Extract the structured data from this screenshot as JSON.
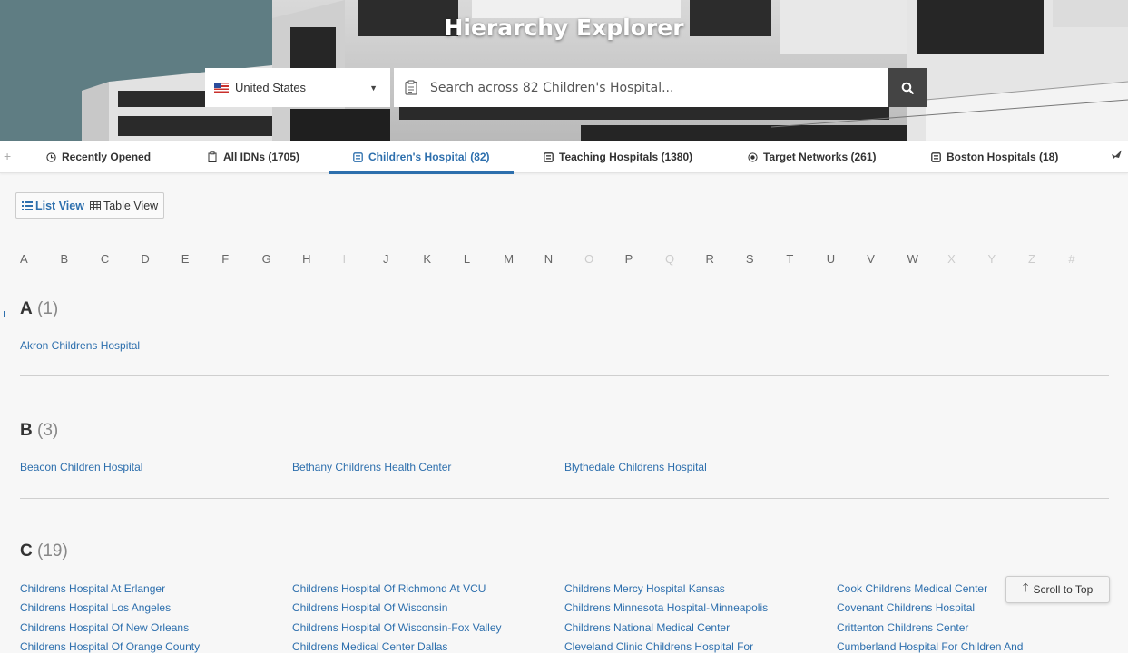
{
  "header": {
    "title": "Hierarchy Explorer",
    "country": "United States",
    "search_placeholder": "Search across 82 Children's Hospital..."
  },
  "tabs": [
    {
      "label": "Recently Opened",
      "icon": "clock-icon"
    },
    {
      "label": "All IDNs (1705)",
      "icon": "clipboard-icon"
    },
    {
      "label": "Children's Hospital (82)",
      "icon": "list-box-icon",
      "active": true
    },
    {
      "label": "Teaching Hospitals (1380)",
      "icon": "list-box-icon"
    },
    {
      "label": "Target Networks (261)",
      "icon": "target-icon"
    },
    {
      "label": "Boston Hospitals (18)",
      "icon": "list-box-icon"
    }
  ],
  "view_toggle": {
    "list_label": "List View",
    "table_label": "Table View"
  },
  "alphabet": [
    "A",
    "B",
    "C",
    "D",
    "E",
    "F",
    "G",
    "H",
    "I",
    "J",
    "K",
    "L",
    "M",
    "N",
    "O",
    "P",
    "Q",
    "R",
    "S",
    "T",
    "U",
    "V",
    "W",
    "X",
    "Y",
    "Z",
    "#"
  ],
  "alphabet_disabled": [
    "I",
    "O",
    "Q",
    "X",
    "Y",
    "Z",
    "#"
  ],
  "sections": [
    {
      "letter": "A",
      "count": "(1)",
      "items": [
        "Akron Childrens Hospital"
      ]
    },
    {
      "letter": "B",
      "count": "(3)",
      "items": [
        "Beacon Children Hospital",
        "Bethany Childrens Health Center",
        "Blythedale Childrens Hospital"
      ]
    },
    {
      "letter": "C",
      "count": "(19)",
      "items": [
        "Childrens Hospital At Erlanger",
        "Childrens Hospital Of Richmond At VCU",
        "Childrens Mercy Hospital Kansas",
        "Cook Childrens Medical Center",
        "Childrens Hospital Los Angeles",
        "Childrens Hospital Of Wisconsin",
        "Childrens Minnesota Hospital-Minneapolis",
        "Covenant Childrens Hospital",
        "Childrens Hospital Of New Orleans",
        "Childrens Hospital Of Wisconsin-Fox Valley",
        "Childrens National Medical Center",
        "Crittenton Childrens Center",
        "Childrens Hospital Of Orange County",
        "Childrens Medical Center Dallas",
        "Cleveland Clinic Childrens Hospital For",
        "Cumberland Hospital For Children And"
      ]
    }
  ],
  "scroll_top_label": "Scroll to Top"
}
